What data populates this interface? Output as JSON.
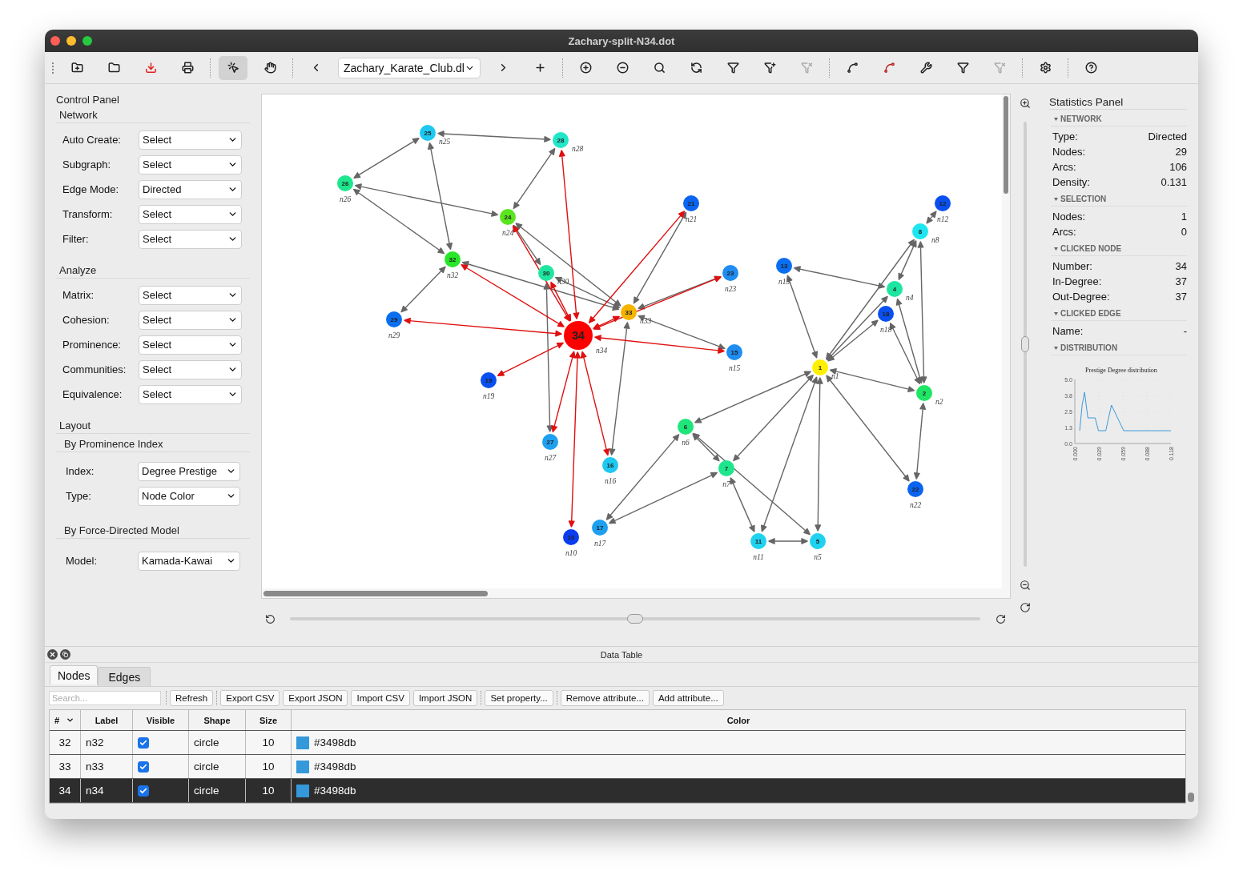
{
  "window": {
    "title": "Zachary-split-N34.dot"
  },
  "toolbar": {
    "file_selector": "Zachary_Karate_Club.dl",
    "modes": [
      {
        "selected": true
      },
      {
        "selected": false
      }
    ]
  },
  "control_panel": {
    "title": "Control Panel",
    "sections": [
      {
        "title": "Network",
        "groups": [
          {
            "fields": [
              {
                "label": "Auto Create:",
                "value": "Select"
              },
              {
                "label": "Subgraph:",
                "value": "Select"
              },
              {
                "label": "Edge Mode:",
                "value": "Directed"
              },
              {
                "label": "Transform:",
                "value": "Select"
              },
              {
                "label": "Filter:",
                "value": "Select"
              }
            ]
          }
        ]
      },
      {
        "title": "Analyze",
        "groups": [
          {
            "fields": [
              {
                "label": "Matrix:",
                "value": "Select"
              },
              {
                "label": "Cohesion:",
                "value": "Select"
              },
              {
                "label": "Prominence:",
                "value": "Select"
              },
              {
                "label": "Communities:",
                "value": "Select"
              },
              {
                "label": "Equivalence:",
                "value": "Select"
              }
            ]
          }
        ]
      },
      {
        "title": "Layout",
        "groups": [
          {
            "title": "By Prominence Index",
            "fields": [
              {
                "label": "Index:",
                "value": "Degree Prestige"
              },
              {
                "label": "Type:",
                "value": "Node Color"
              }
            ]
          },
          {
            "title": "By Force-Directed Model",
            "fields": [
              {
                "label": "Model:",
                "value": "Kamada-Kawai"
              }
            ]
          }
        ]
      }
    ]
  },
  "graph": {
    "nodes": [
      {
        "number": "25",
        "label": "n25",
        "color": "#1ec8f0",
        "selected": false
      },
      {
        "number": "28",
        "label": "n28",
        "color": "#22e6c8",
        "selected": false
      },
      {
        "number": "26",
        "label": "n26",
        "color": "#1ee68c",
        "selected": false
      },
      {
        "number": "24",
        "label": "n24",
        "color": "#5ae61e",
        "selected": false
      },
      {
        "number": "21",
        "label": "n21",
        "color": "#0a64f0",
        "selected": false
      },
      {
        "number": "32",
        "label": "n32",
        "color": "#28e628",
        "selected": false
      },
      {
        "number": "30",
        "label": "n30",
        "color": "#1ee6a0",
        "selected": false
      },
      {
        "number": "23",
        "label": "n23",
        "color": "#1e8cf0",
        "selected": false
      },
      {
        "number": "33",
        "label": "n33",
        "color": "#f5b400",
        "selected": false
      },
      {
        "number": "29",
        "label": "n29",
        "color": "#0a6ef0",
        "selected": false
      },
      {
        "number": "34",
        "label": "n34",
        "color": "#ff0000",
        "selected": true
      },
      {
        "number": "15",
        "label": "n15",
        "color": "#1e8cf0",
        "selected": false
      },
      {
        "number": "19",
        "label": "n19",
        "color": "#0a50f0",
        "selected": false
      },
      {
        "number": "27",
        "label": "n27",
        "color": "#1ea0f0",
        "selected": false
      },
      {
        "number": "16",
        "label": "n16",
        "color": "#1ec8f0",
        "selected": false
      },
      {
        "number": "10",
        "label": "n10",
        "color": "#0a3cf0",
        "selected": false
      },
      {
        "number": "17",
        "label": "n17",
        "color": "#1ea0f0",
        "selected": false
      },
      {
        "number": "6",
        "label": "n6",
        "color": "#1ee67a",
        "selected": false
      },
      {
        "number": "7",
        "label": "n7",
        "color": "#1ee68c",
        "selected": false
      },
      {
        "number": "11",
        "label": "n11",
        "color": "#1ed2f0",
        "selected": false
      },
      {
        "number": "5",
        "label": "n5",
        "color": "#1ed2f0",
        "selected": false
      },
      {
        "number": "1",
        "label": "n1",
        "color": "#fff000",
        "selected": false
      },
      {
        "number": "2",
        "label": "n2",
        "color": "#1ee664",
        "selected": false
      },
      {
        "number": "22",
        "label": "n22",
        "color": "#0a64f0",
        "selected": false
      },
      {
        "number": "13",
        "label": "n13",
        "color": "#0a6ef0",
        "selected": false
      },
      {
        "number": "4",
        "label": "n4",
        "color": "#1ee6a0",
        "selected": false
      },
      {
        "number": "18",
        "label": "n18",
        "color": "#0a50f0",
        "selected": false
      },
      {
        "number": "8",
        "label": "n8",
        "color": "#1ee6f0",
        "selected": false
      },
      {
        "number": "12",
        "label": "n12",
        "color": "#0a50f0",
        "selected": false
      }
    ]
  },
  "zoom_slider": {
    "level": 0.5
  },
  "rotation_slider": {
    "level": 0.5
  },
  "statistics_panel": {
    "title": "Statistics Panel",
    "sections": [
      {
        "title": "NETWORK",
        "rows": [
          {
            "label": "Type:",
            "value": "Directed"
          },
          {
            "label": "Nodes:",
            "value": "29"
          },
          {
            "label": "Arcs:",
            "value": "106"
          },
          {
            "label": "Density:",
            "value": "0.131"
          }
        ]
      },
      {
        "title": "SELECTION",
        "rows": [
          {
            "label": "Nodes:",
            "value": "1"
          },
          {
            "label": "Arcs:",
            "value": "0"
          }
        ]
      },
      {
        "title": "CLICKED NODE",
        "rows": [
          {
            "label": "Number:",
            "value": "34"
          },
          {
            "label": "In-Degree:",
            "value": "37"
          },
          {
            "label": "Out-Degree:",
            "value": "37"
          }
        ]
      },
      {
        "title": "CLICKED EDGE",
        "rows": [
          {
            "label": "Name:",
            "value": "-"
          }
        ]
      },
      {
        "title": "DISTRIBUTION"
      }
    ],
    "chart_data": {
      "type": "line",
      "title": "Prestige Degree distribution",
      "x": [
        0.006,
        0.009,
        0.012,
        0.016,
        0.025,
        0.029,
        0.038,
        0.045,
        0.06,
        0.118
      ],
      "series": [
        {
          "color": "#3a9ad9",
          "values": [
            1,
            3,
            4,
            2,
            2,
            1,
            1,
            3,
            1,
            1
          ]
        }
      ],
      "xlim": [
        0,
        0.118
      ],
      "ylim": [
        0,
        5
      ],
      "xticks": [
        {
          "value": 0,
          "label": "0.000"
        },
        {
          "value": 0.0295,
          "label": "0.029"
        },
        {
          "value": 0.059,
          "label": "0.059"
        },
        {
          "value": 0.0885,
          "label": "0.088"
        },
        {
          "value": 0.118,
          "label": "0.118"
        }
      ],
      "yticks": [
        {
          "value": 0,
          "label": "0.0"
        },
        {
          "value": 1.25,
          "label": "1.3"
        },
        {
          "value": 2.5,
          "label": "2.5"
        },
        {
          "value": 3.75,
          "label": "3.8"
        },
        {
          "value": 5,
          "label": "5.0"
        }
      ]
    }
  },
  "data_table": {
    "title": "Data Table",
    "tabs": [
      {
        "label": "Nodes",
        "selected": true
      },
      {
        "label": "Edges",
        "selected": false
      }
    ],
    "search": {
      "placeholder": "Search..."
    },
    "buttons": [
      "Refresh",
      "Export CSV",
      "Export JSON",
      "Import CSV",
      "Import JSON",
      "Set property...",
      "Remove attribute...",
      "Add attribute..."
    ],
    "columns": [
      "#",
      "Label",
      "Visible",
      "Shape",
      "Size",
      "Color"
    ],
    "rows": [
      {
        "number": "32",
        "label": "n32",
        "visible": true,
        "shape": "circle",
        "size": "10",
        "color_text": "#3498db",
        "color": "#3498db",
        "selected": false
      },
      {
        "number": "33",
        "label": "n33",
        "visible": true,
        "shape": "circle",
        "size": "10",
        "color_text": "#3498db",
        "color": "#3498db",
        "selected": false
      },
      {
        "number": "34",
        "label": "n34",
        "visible": true,
        "shape": "circle",
        "size": "10",
        "color_text": "#3498db",
        "color": "#3498db",
        "selected": true
      }
    ]
  }
}
